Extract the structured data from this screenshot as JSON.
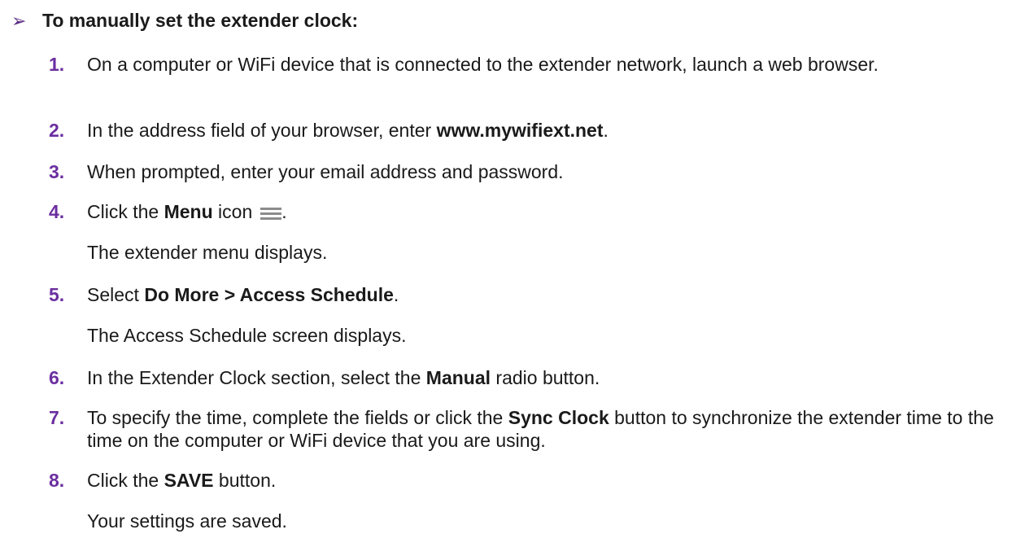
{
  "heading": {
    "bullet": "➢",
    "title": "To manually set the extender clock:"
  },
  "steps": [
    {
      "num": "1.",
      "text": "On a computer or WiFi device that is connected to the extender network, launch a web browser."
    },
    {
      "num": "2.",
      "pre": "In the address field of your browser, enter ",
      "bold": "www.mywifiext.net",
      "post": "."
    },
    {
      "num": "3.",
      "text": "When prompted, enter your email address and password."
    },
    {
      "num": "4.",
      "pre": "Click the ",
      "bold": "Menu",
      "post": " icon",
      "icon": "menu-icon",
      "end": ".",
      "note": "The extender menu displays."
    },
    {
      "num": "5.",
      "pre": "Select ",
      "bold": "Do More > Access Schedule",
      "post": ".",
      "note": "The Access Schedule screen displays."
    },
    {
      "num": "6.",
      "pre": "In the Extender Clock section, select the ",
      "bold": "Manual",
      "post": " radio button."
    },
    {
      "num": "7.",
      "pre": "To specify the time, complete the fields or click the ",
      "bold": "Sync Clock",
      "post": " button to synchronize the extender time to the time on the computer or WiFi device that you are using."
    },
    {
      "num": "8.",
      "pre": "Click the ",
      "bold": "SAVE",
      "post": " button.",
      "note": "Your settings are saved."
    }
  ]
}
